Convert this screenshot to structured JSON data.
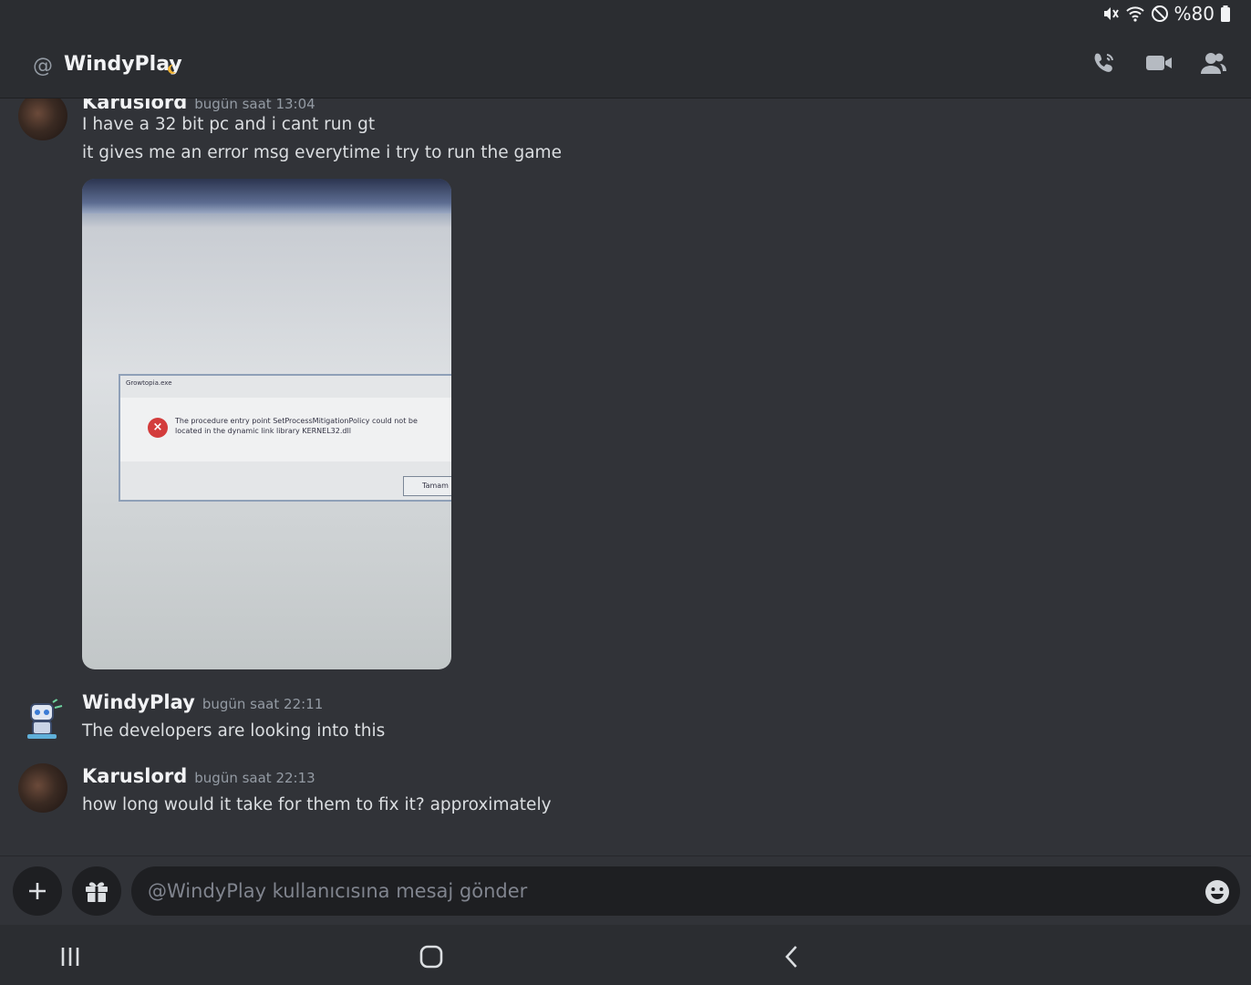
{
  "status_bar": {
    "battery": "%80"
  },
  "header": {
    "channel_name": "WindyPlay"
  },
  "messages": {
    "m1": {
      "author": "Karuslord",
      "timestamp": "bugün saat 13:04",
      "lines": [
        "I have a 32 bit pc and i cant run gt",
        "it gives me an error msg everytime i try to run the game"
      ],
      "attachment": {
        "dialog_title": "Growtopia.exe",
        "dialog_line1": "The procedure entry point SetProcessMitigationPolicy could not be",
        "dialog_line2": "located in the dynamic link library KERNEL32.dll",
        "dialog_button": "Tamam"
      }
    },
    "m2": {
      "author": "WindyPlay",
      "timestamp": "bugün saat 22:11",
      "text": "The developers are looking into this"
    },
    "m3": {
      "author": "Karuslord",
      "timestamp": "bugün saat 22:13",
      "text": "how long would it take for them to fix it? approximately"
    }
  },
  "composer": {
    "placeholder": "@WindyPlay kullanıcısına mesaj gönder"
  },
  "colors": {
    "background": "#313338",
    "header": "#2b2d31",
    "input": "#1e1f22",
    "muted": "#949ba4"
  }
}
